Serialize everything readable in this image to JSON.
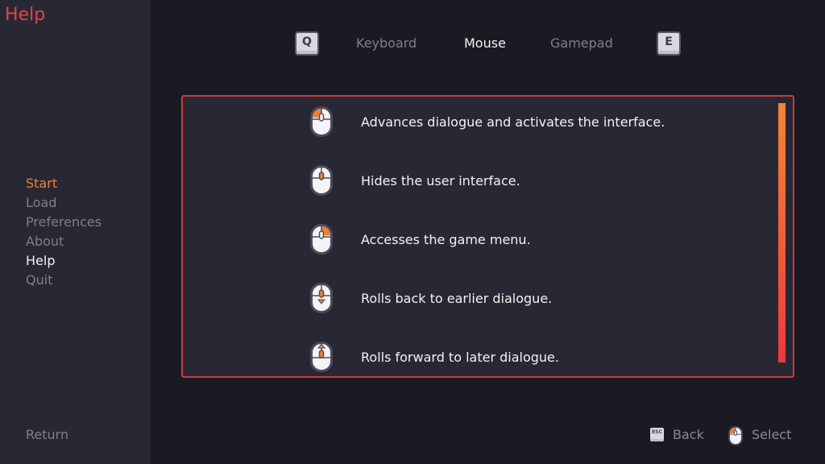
{
  "screen_title": "Help",
  "navigation": {
    "items": [
      {
        "label": "Start",
        "state": "accent"
      },
      {
        "label": "Load",
        "state": "normal"
      },
      {
        "label": "Preferences",
        "state": "normal"
      },
      {
        "label": "About",
        "state": "normal"
      },
      {
        "label": "Help",
        "state": "current"
      },
      {
        "label": "Quit",
        "state": "normal"
      }
    ],
    "return_label": "Return"
  },
  "tabs": {
    "prev_key": "Q",
    "next_key": "E",
    "items": [
      {
        "label": "Keyboard",
        "selected": false
      },
      {
        "label": "Mouse",
        "selected": true
      },
      {
        "label": "Gamepad",
        "selected": false
      }
    ]
  },
  "mouse_bindings": [
    {
      "icon": "mouse-left-click-icon",
      "description": "Advances dialogue and activates the interface."
    },
    {
      "icon": "mouse-middle-click-icon",
      "description": "Hides the user interface."
    },
    {
      "icon": "mouse-right-click-icon",
      "description": "Accesses the game menu."
    },
    {
      "icon": "mouse-scroll-down-icon",
      "description": "Rolls back to earlier dialogue."
    },
    {
      "icon": "mouse-scroll-up-icon",
      "description": "Rolls forward to later dialogue."
    }
  ],
  "footer": {
    "back_key": "ESC",
    "back_label": "Back",
    "select_label": "Select"
  },
  "colors": {
    "accent_orange": "#f07f35",
    "accent_red": "#e04545",
    "panel_border": "#d0383c",
    "text_primary": "#f2f2f2",
    "text_muted": "#7f7f88"
  }
}
